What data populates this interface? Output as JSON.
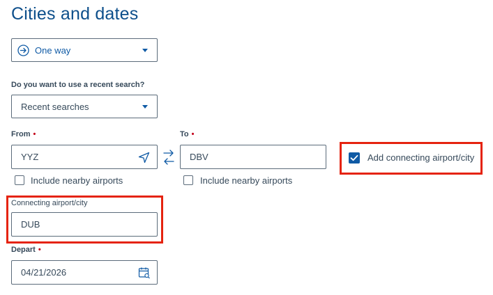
{
  "title": "Cities and dates",
  "trip_type": {
    "selected": "One way"
  },
  "recent_search": {
    "question": "Do you want to use a recent search?",
    "selected": "Recent searches"
  },
  "from": {
    "label": "From",
    "required_mark": "•",
    "value": "YYZ",
    "nearby_label": "Include nearby airports"
  },
  "to": {
    "label": "To",
    "required_mark": "•",
    "value": "DBV",
    "nearby_label": "Include nearby airports"
  },
  "connecting": {
    "checkbox_label": "Add connecting airport/city",
    "checked": true,
    "field_label": "Connecting airport/city",
    "value": "DUB"
  },
  "depart": {
    "label": "Depart",
    "required_mark": "•",
    "value": "04/21/2026"
  },
  "colors": {
    "brand_blue": "#0f5aa5",
    "title_blue": "#0d4f8b",
    "highlight_red": "#e5230f",
    "required_red": "#c30019"
  }
}
